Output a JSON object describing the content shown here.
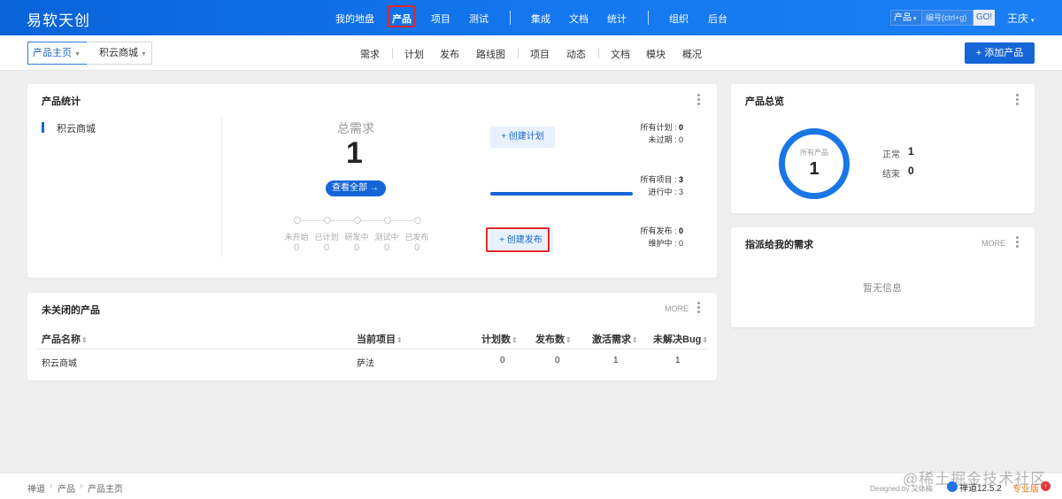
{
  "topbar": {
    "brand": "易软天创",
    "nav": [
      "我的地盘",
      "产品",
      "项目",
      "测试",
      "集成",
      "文档",
      "统计",
      "组织",
      "后台"
    ],
    "search_type": "产品",
    "search_placeholder": "编号(ctrl+g)",
    "search_go": "GO!",
    "user": "王庆"
  },
  "subbar": {
    "home": "产品主页",
    "product": "积云商城",
    "items": [
      "需求",
      "计划",
      "发布",
      "路线图",
      "项目",
      "动态",
      "文档",
      "模块",
      "概况"
    ],
    "add_product": "+ 添加产品"
  },
  "stats": {
    "title": "产品统计",
    "product": "积云商城",
    "total_label": "总需求",
    "total_value": "1",
    "view_all": "查看全部 →",
    "stages": [
      {
        "label": "未开始",
        "count": "0"
      },
      {
        "label": "已计划",
        "count": "0"
      },
      {
        "label": "研发中",
        "count": "0"
      },
      {
        "label": "测试中",
        "count": "0"
      },
      {
        "label": "已发布",
        "count": "0"
      }
    ],
    "create_plan": "+ 创建计划",
    "create_release": "+ 创建发布",
    "rows": [
      {
        "label": "所有计划",
        "value": "0"
      },
      {
        "label": "未过期",
        "value": "0"
      },
      {
        "label": "所有项目",
        "value": "3"
      },
      {
        "label": "进行中",
        "value": "3"
      },
      {
        "label": "所有发布",
        "value": "0"
      },
      {
        "label": "维护中",
        "value": "0"
      }
    ]
  },
  "overview": {
    "title": "产品总览",
    "ring_label": "所有产品",
    "ring_value": "1",
    "normal_label": "正常",
    "normal_value": "1",
    "closed_label": "结束",
    "closed_value": "0"
  },
  "assigned": {
    "title": "指派给我的需求",
    "more": "MORE",
    "empty": "暂无信息"
  },
  "open_products": {
    "title": "未关闭的产品",
    "more": "MORE",
    "columns": [
      "产品名称",
      "当前项目",
      "计划数",
      "发布数",
      "激活需求",
      "未解决Bug"
    ],
    "rows": [
      {
        "name": "积云商城",
        "project": "萨法",
        "plans": "0",
        "releases": "0",
        "active": "1",
        "bugs": "1"
      }
    ]
  },
  "footer": {
    "crumbs": [
      "禅道",
      "产品",
      "产品主页"
    ],
    "designed_by": "Designed by 又体稿",
    "version": "禅道12.5.2",
    "edition": "专业版"
  },
  "watermark": "@稀土掘金技术社区",
  "colors": {
    "primary": "#1565d6",
    "highlight": "#e0252b"
  }
}
